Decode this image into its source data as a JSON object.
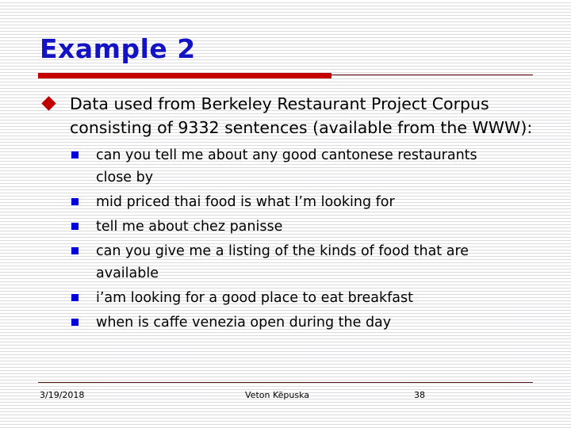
{
  "slide": {
    "title": "Example 2",
    "colors": {
      "title_blue": "#1313c4",
      "rule_red": "#c40000",
      "rule_dark": "#5a0a0a",
      "diamond_bullet_red": "#c00000",
      "square_bullet_blue": "#0000d8",
      "body_text": "#000000",
      "background": "#ffffff"
    },
    "body": {
      "level1": [
        {
          "bullet": "diamond-bullet-icon",
          "text": "Data used from Berkeley Restaurant Project Corpus consisting of 9332 sentences (available from the WWW):"
        }
      ],
      "level2": [
        {
          "bullet": "square-bullet-icon",
          "text": "can you tell me about any good cantonese restaurants close by"
        },
        {
          "bullet": "square-bullet-icon",
          "text": "mid priced thai food is what I’m looking for"
        },
        {
          "bullet": "square-bullet-icon",
          "text": "tell me about chez panisse"
        },
        {
          "bullet": "square-bullet-icon",
          "text": "can you give me a listing of the kinds of food that are available"
        },
        {
          "bullet": "square-bullet-icon",
          "text": "i’am looking for a good place to eat breakfast"
        },
        {
          "bullet": "square-bullet-icon",
          "text": "when is caffe venezia open during the day"
        }
      ]
    },
    "footer": {
      "date": "3/19/2018",
      "author": "Veton Këpuska",
      "page_number": "38"
    }
  }
}
